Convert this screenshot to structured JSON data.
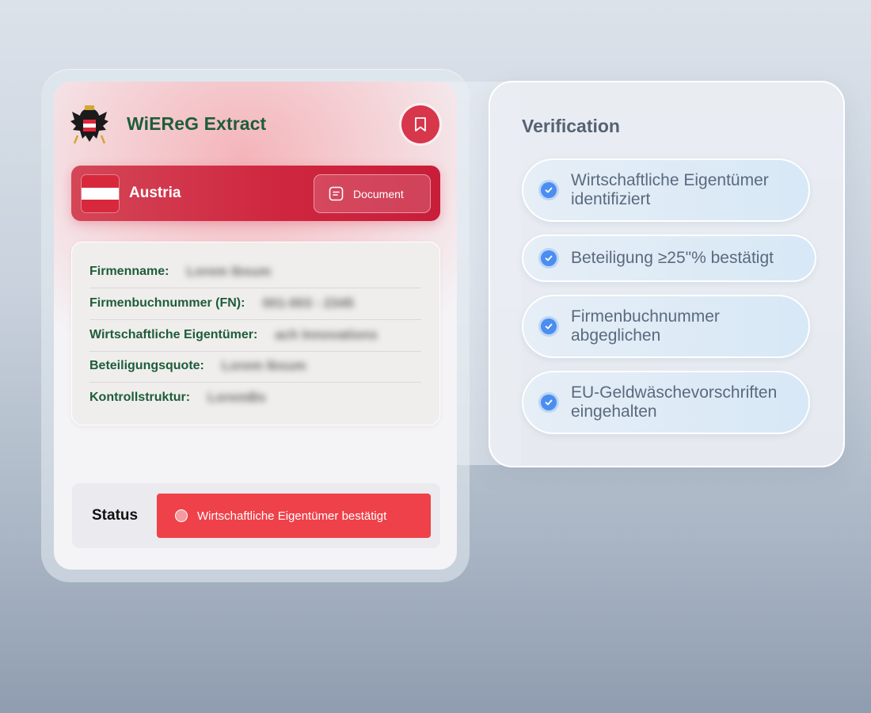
{
  "card": {
    "title": "WiEReG Extract",
    "country": "Austria",
    "document_button": "Document",
    "details": [
      {
        "label": "Firmenname:",
        "value": "Lorem Ibsum"
      },
      {
        "label": "Firmenbuchnummer (FN):",
        "value": "001-003 - 2345"
      },
      {
        "label": "Wirtschaftliche Eigentümer:",
        "value": "ach Innovations"
      },
      {
        "label": "Beteiligungsquote:",
        "value": "Lorem Ibsum"
      },
      {
        "label": "Kontrollstruktur:",
        "value": "LoremBs"
      }
    ],
    "status_label": "Status",
    "status_value": "Wirtschaftliche Eigentümer bestätigt"
  },
  "verification": {
    "title": "Verification",
    "items": [
      {
        "line1": "Wirtschaftliche Eigentümer",
        "line2": "identifiziert"
      },
      {
        "line1": "Beteiligung ≥25\"% bestätigt",
        "line2": ""
      },
      {
        "line1": "Firmenbuchnummer",
        "line2": "abgeglichen"
      },
      {
        "line1": "EU-Geldwäschevorschriften",
        "line2": "eingehalten"
      }
    ]
  },
  "icons": [
    "austria-coat-of-arms-icon",
    "bookmark-icon",
    "document-icon",
    "check-icon"
  ],
  "colors": {
    "brand_green": "#1e5d3a",
    "accent_red": "#cf2740",
    "status_red": "#ef4149",
    "check_blue": "#4a8ef0"
  }
}
